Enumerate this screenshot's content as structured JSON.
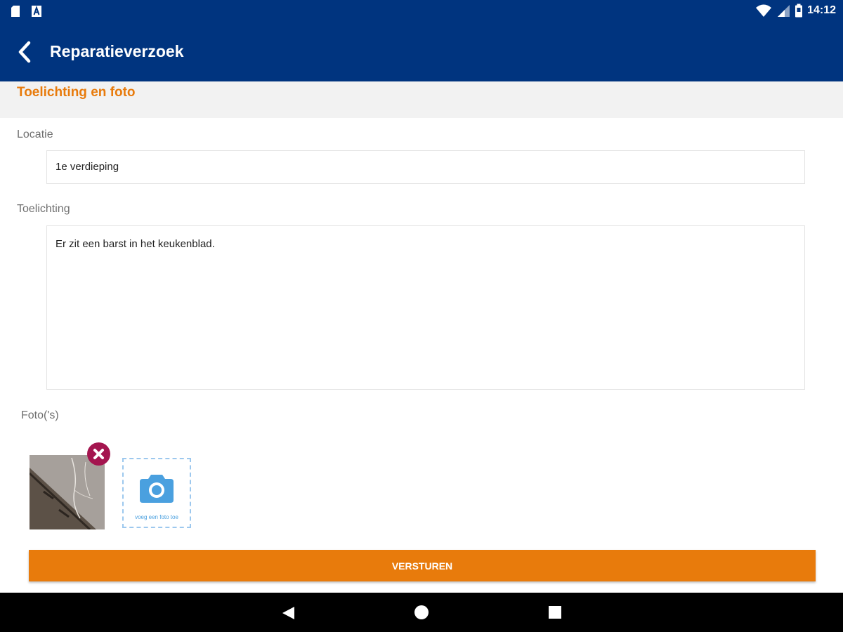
{
  "status_bar": {
    "time": "14:12",
    "left_icons": [
      "sd-card-icon",
      "a-notification-icon"
    ],
    "right_icons": [
      "wifi-icon",
      "signal-icon",
      "battery-icon"
    ]
  },
  "app_bar": {
    "title": "Reparatieverzoek",
    "background": "#00347f"
  },
  "section": {
    "title": "Toelichting en foto",
    "title_color": "#e87b0c"
  },
  "form": {
    "locatie_label": "Locatie",
    "locatie_value": "1e verdieping",
    "toelichting_label": "Toelichting",
    "toelichting_value": "Er zit een barst in het keukenblad.",
    "fotos_label": "Foto('s)",
    "add_photo_label": "voeg een foto toe"
  },
  "submit": {
    "label": "VERSTUREN",
    "color": "#e87b0c"
  },
  "nav_bar": {
    "icons": [
      "back-triangle-icon",
      "home-circle-icon",
      "recents-square-icon"
    ]
  }
}
